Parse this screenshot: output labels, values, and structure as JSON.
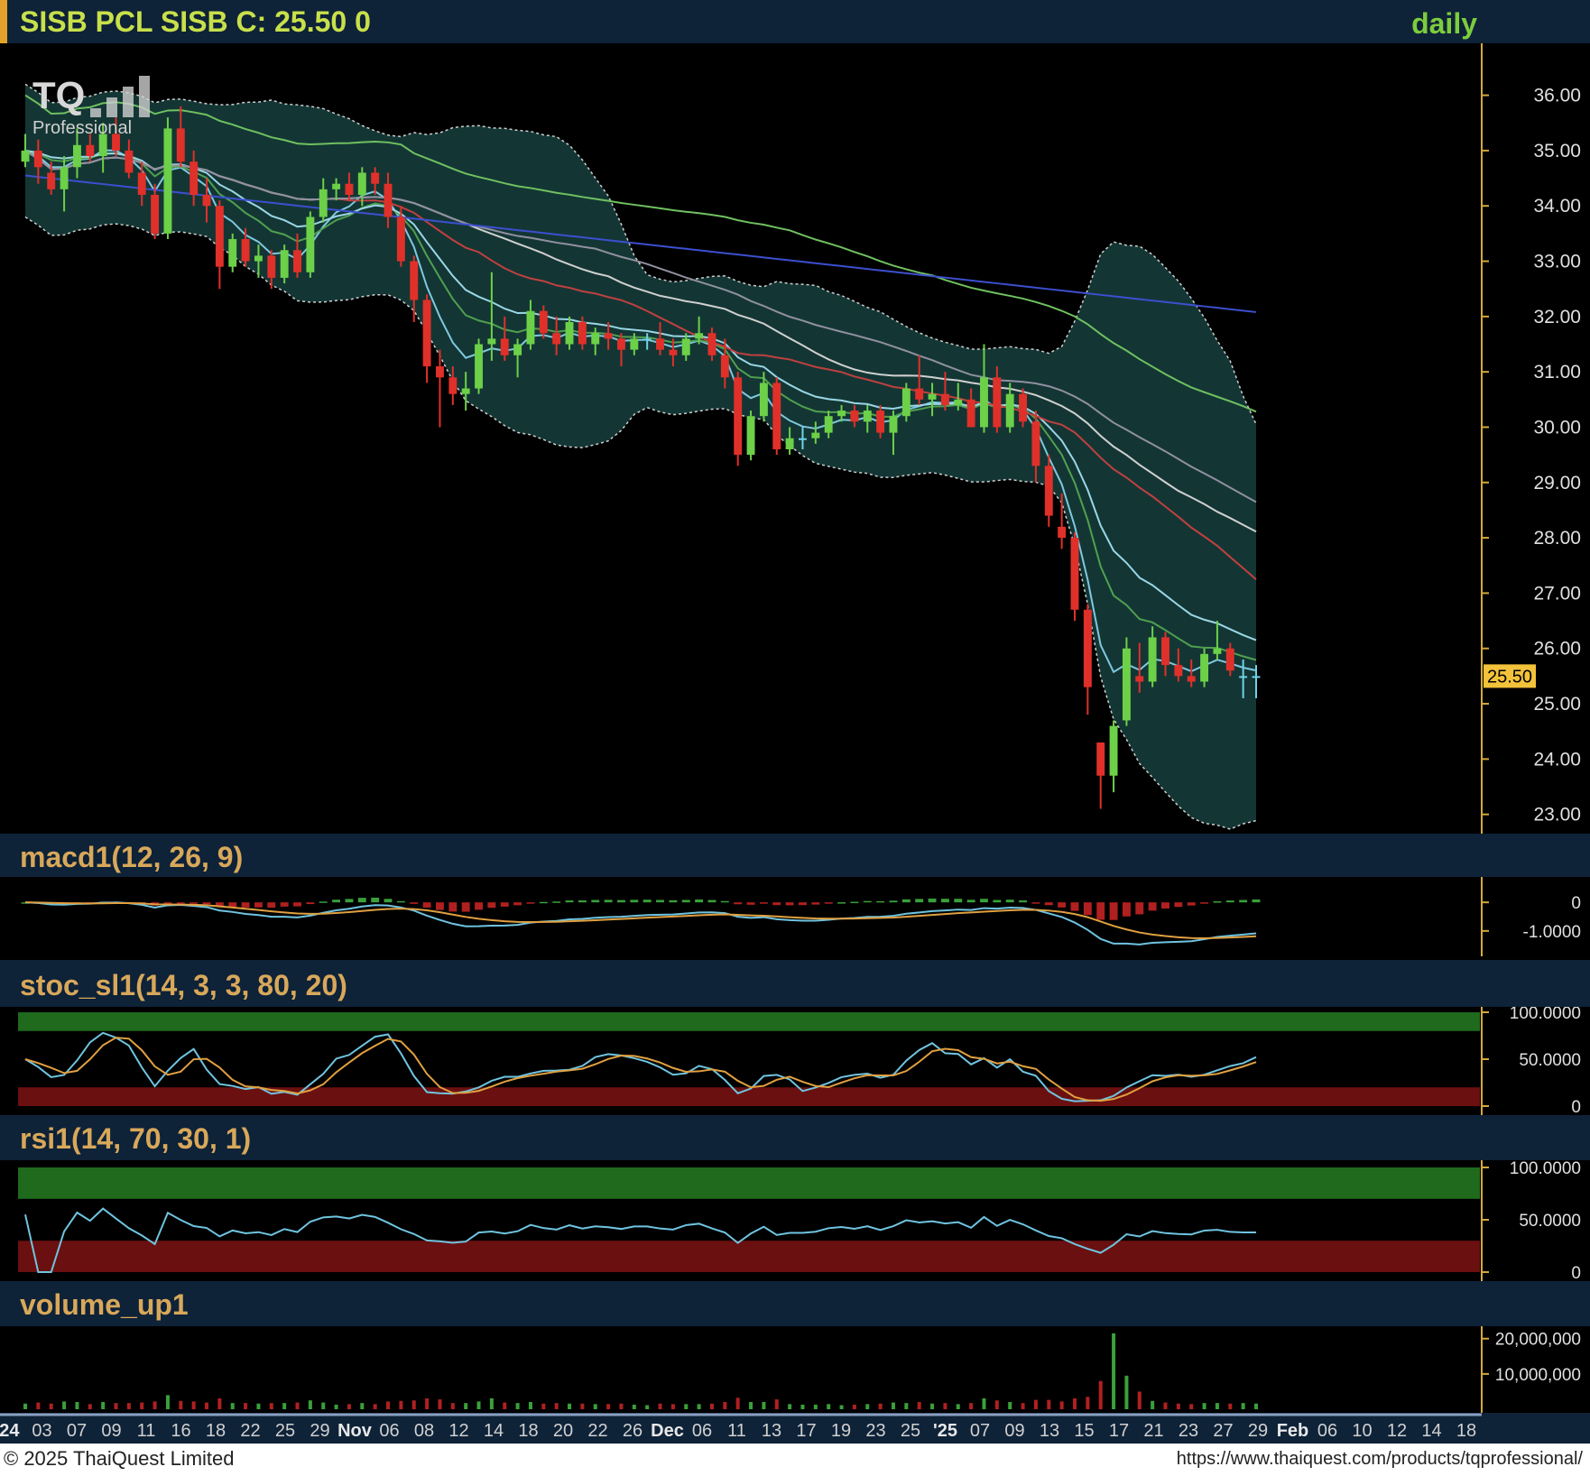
{
  "header": {
    "title": "SISB PCL SISB C: 25.50 0",
    "timeframe": "daily",
    "logo_text": "TQ",
    "logo_sub": "Professional"
  },
  "last_price_label": "25.50",
  "panels": {
    "macd": "macd1(12, 26, 9)",
    "stoch": "stoc_sl1(14, 3, 3, 80, 20)",
    "rsi": "rsi1(14, 70, 30, 1)",
    "volume": "volume_up1"
  },
  "footer": {
    "copyright": "© 2025 ThaiQuest Limited",
    "url": "https://www.thaiquest.com/products/tqprofessional/"
  },
  "colors": {
    "up": "#6cd048",
    "down": "#e0302a",
    "neutral": "#6fd3e8",
    "band_fill": "#16403d",
    "header_bg": "#0e2238",
    "ma_blue": "#3c4fd0",
    "ma_green": "#70c060"
  },
  "chart_data": {
    "type": "candlestick",
    "price_axis": {
      "ticks": [
        23,
        24,
        25,
        26,
        27,
        28,
        29,
        30,
        31,
        32,
        33,
        34,
        35,
        36
      ],
      "tick_labels": [
        "23.00",
        "24.00",
        "25.00",
        "26.00",
        "27.00",
        "28.00",
        "29.00",
        "30.00",
        "31.00",
        "32.00",
        "33.00",
        "34.00",
        "35.00",
        "36.00"
      ]
    },
    "x_labels": [
      "'24",
      "03",
      "07",
      "09",
      "11",
      "16",
      "18",
      "22",
      "25",
      "29",
      "Nov",
      "06",
      "08",
      "12",
      "14",
      "18",
      "20",
      "22",
      "26",
      "Dec",
      "06",
      "11",
      "13",
      "17",
      "19",
      "23",
      "25",
      "'25",
      "07",
      "09",
      "13",
      "15",
      "17",
      "21",
      "23",
      "27",
      "29",
      "Feb",
      "06",
      "10",
      "12",
      "14",
      "18"
    ],
    "ohlc": [
      [
        34.8,
        35.3,
        34.7,
        35.0
      ],
      [
        35.0,
        35.2,
        34.4,
        34.7
      ],
      [
        34.6,
        34.8,
        34.2,
        34.3
      ],
      [
        34.3,
        34.9,
        33.9,
        34.7
      ],
      [
        34.7,
        35.4,
        34.5,
        35.1
      ],
      [
        35.1,
        35.3,
        34.8,
        34.9
      ],
      [
        34.9,
        35.5,
        34.6,
        35.3
      ],
      [
        35.3,
        35.6,
        34.9,
        35.0
      ],
      [
        35.0,
        35.2,
        34.5,
        34.6
      ],
      [
        34.6,
        34.8,
        34.0,
        34.2
      ],
      [
        34.2,
        34.4,
        33.4,
        33.5
      ],
      [
        33.5,
        35.6,
        33.4,
        35.4
      ],
      [
        35.4,
        35.8,
        34.7,
        34.8
      ],
      [
        34.8,
        35.0,
        34.0,
        34.2
      ],
      [
        34.2,
        34.5,
        33.7,
        34.0
      ],
      [
        34.0,
        34.1,
        32.5,
        32.9
      ],
      [
        32.9,
        33.5,
        32.8,
        33.4
      ],
      [
        33.4,
        33.6,
        32.9,
        33.0
      ],
      [
        33.0,
        33.3,
        32.7,
        33.1
      ],
      [
        33.1,
        33.2,
        32.5,
        32.7
      ],
      [
        32.7,
        33.3,
        32.6,
        33.2
      ],
      [
        33.2,
        33.5,
        32.7,
        32.8
      ],
      [
        32.8,
        33.9,
        32.7,
        33.8
      ],
      [
        33.8,
        34.5,
        33.7,
        34.3
      ],
      [
        34.3,
        34.5,
        34.1,
        34.4
      ],
      [
        34.4,
        34.6,
        34.1,
        34.2
      ],
      [
        34.2,
        34.7,
        34.0,
        34.6
      ],
      [
        34.6,
        34.7,
        34.2,
        34.4
      ],
      [
        34.4,
        34.6,
        33.6,
        33.8
      ],
      [
        33.8,
        34.0,
        32.9,
        33.0
      ],
      [
        33.0,
        33.1,
        31.9,
        32.3
      ],
      [
        32.3,
        32.4,
        30.8,
        31.1
      ],
      [
        31.1,
        31.4,
        30.0,
        30.9
      ],
      [
        30.9,
        31.1,
        30.4,
        30.6
      ],
      [
        30.6,
        31.0,
        30.3,
        30.7
      ],
      [
        30.7,
        31.6,
        30.6,
        31.5
      ],
      [
        31.5,
        32.8,
        31.2,
        31.6
      ],
      [
        31.6,
        32.0,
        31.2,
        31.3
      ],
      [
        31.3,
        31.6,
        30.9,
        31.5
      ],
      [
        31.5,
        32.3,
        31.4,
        32.1
      ],
      [
        32.1,
        32.2,
        31.6,
        31.7
      ],
      [
        31.7,
        32.0,
        31.3,
        31.5
      ],
      [
        31.5,
        32.0,
        31.4,
        31.9
      ],
      [
        31.9,
        32.0,
        31.4,
        31.5
      ],
      [
        31.5,
        31.8,
        31.3,
        31.7
      ],
      [
        31.7,
        31.9,
        31.4,
        31.6
      ],
      [
        31.6,
        31.7,
        31.1,
        31.4
      ],
      [
        31.4,
        31.7,
        31.3,
        31.6
      ],
      [
        31.6,
        31.7,
        31.4,
        31.6
      ],
      [
        31.6,
        31.9,
        31.3,
        31.4
      ],
      [
        31.4,
        31.6,
        31.1,
        31.3
      ],
      [
        31.3,
        31.7,
        31.2,
        31.6
      ],
      [
        31.6,
        32.0,
        31.5,
        31.7
      ],
      [
        31.7,
        31.8,
        31.2,
        31.3
      ],
      [
        31.3,
        31.6,
        30.7,
        30.9
      ],
      [
        30.9,
        31.0,
        29.3,
        29.5
      ],
      [
        29.5,
        30.3,
        29.4,
        30.2
      ],
      [
        30.2,
        31.0,
        30.1,
        30.8
      ],
      [
        30.8,
        30.9,
        29.5,
        29.6
      ],
      [
        29.6,
        30.0,
        29.5,
        29.8
      ],
      [
        29.8,
        30.0,
        29.6,
        29.8
      ],
      [
        29.8,
        30.1,
        29.7,
        29.9
      ],
      [
        29.9,
        30.3,
        29.8,
        30.2
      ],
      [
        30.2,
        30.4,
        30.1,
        30.3
      ],
      [
        30.3,
        30.4,
        30.0,
        30.1
      ],
      [
        30.1,
        30.4,
        29.9,
        30.3
      ],
      [
        30.3,
        30.4,
        29.8,
        29.9
      ],
      [
        29.9,
        30.3,
        29.5,
        30.2
      ],
      [
        30.2,
        30.8,
        30.1,
        30.7
      ],
      [
        30.7,
        31.3,
        30.4,
        30.5
      ],
      [
        30.5,
        30.8,
        30.2,
        30.6
      ],
      [
        30.6,
        31.0,
        30.3,
        30.4
      ],
      [
        30.4,
        30.8,
        30.3,
        30.5
      ],
      [
        30.5,
        30.7,
        30.0,
        30.0
      ],
      [
        30.0,
        31.5,
        29.9,
        30.9
      ],
      [
        30.9,
        31.1,
        29.9,
        30.0
      ],
      [
        30.0,
        30.8,
        29.9,
        30.6
      ],
      [
        30.6,
        30.7,
        30.0,
        30.1
      ],
      [
        30.1,
        30.3,
        29.0,
        29.3
      ],
      [
        29.3,
        29.5,
        28.2,
        28.4
      ],
      [
        28.2,
        28.8,
        27.8,
        28.0
      ],
      [
        28.0,
        28.1,
        26.5,
        26.7
      ],
      [
        26.7,
        26.8,
        24.8,
        25.3
      ],
      [
        24.3,
        24.3,
        23.1,
        23.7
      ],
      [
        23.7,
        24.7,
        23.4,
        24.6
      ],
      [
        24.7,
        26.2,
        24.6,
        26.0
      ],
      [
        25.5,
        26.1,
        25.2,
        25.4
      ],
      [
        25.4,
        26.4,
        25.3,
        26.2
      ],
      [
        26.2,
        26.3,
        25.5,
        25.7
      ],
      [
        25.7,
        26.0,
        25.4,
        25.5
      ],
      [
        25.5,
        25.8,
        25.3,
        25.4
      ],
      [
        25.4,
        26.0,
        25.3,
        25.9
      ],
      [
        25.9,
        26.5,
        25.8,
        26.0
      ],
      [
        26.0,
        26.1,
        25.5,
        25.6
      ],
      [
        25.5,
        25.8,
        25.1,
        25.5
      ],
      [
        25.5,
        25.7,
        25.1,
        25.5
      ]
    ],
    "volume_axis": {
      "ticks": [
        10000000,
        20000000
      ],
      "tick_labels": [
        "10,000,000",
        "20,000,000"
      ]
    },
    "macd_axis": {
      "ticks": [
        0,
        -1.0
      ],
      "tick_labels": [
        "0",
        "-1.0000"
      ]
    },
    "stoch_axis": {
      "ticks": [
        100,
        50,
        0
      ],
      "tick_labels": [
        "100.0000",
        "50.0000",
        "0"
      ]
    },
    "rsi_axis": {
      "ticks": [
        100,
        50,
        0
      ],
      "tick_labels": [
        "100.0000",
        "50.0000",
        "0"
      ]
    }
  }
}
